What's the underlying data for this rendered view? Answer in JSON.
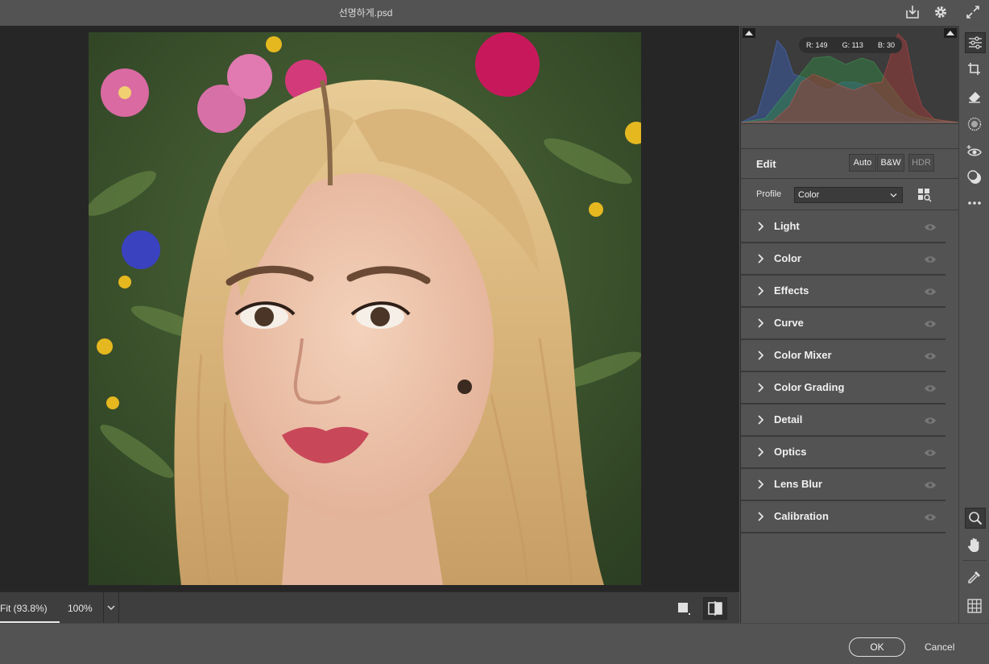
{
  "window": {
    "title": "선명하게.psd"
  },
  "view": {
    "fit_label": "Fit (93.8%)",
    "zoom_label": "100%"
  },
  "histogram": {
    "r_label": "R: 149",
    "g_label": "G: 113",
    "b_label": "B: 30"
  },
  "edit": {
    "title": "Edit",
    "auto_label": "Auto",
    "bw_label": "B&W",
    "hdr_label": "HDR"
  },
  "profile": {
    "label": "Profile",
    "value": "Color"
  },
  "sections": [
    "Light",
    "Color",
    "Effects",
    "Curve",
    "Color Mixer",
    "Color Grading",
    "Detail",
    "Optics",
    "Lens Blur",
    "Calibration"
  ],
  "footer": {
    "ok_label": "OK",
    "cancel_label": "Cancel"
  },
  "colors": {
    "accent_bg": "#535353",
    "canvas_bg": "#262626",
    "histo_red": "#e84a4a",
    "histo_green": "#3ec45a",
    "histo_blue": "#4a7be8"
  },
  "icons": {
    "topbar": [
      "download-icon",
      "gear-icon",
      "expand-icon"
    ],
    "tools": [
      "sliders-icon",
      "crop-icon",
      "eraser-icon",
      "masking-icon",
      "red-eye-icon",
      "presets-icon",
      "more-icon",
      "zoom-icon",
      "hand-icon",
      "eyedropper-icon",
      "grid-icon"
    ]
  }
}
